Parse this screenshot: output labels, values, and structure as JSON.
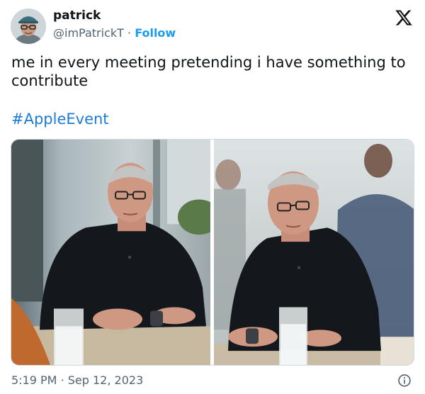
{
  "author": {
    "display_name": "patrick",
    "handle": "@imPatrickT",
    "separator": "·",
    "follow_label": "Follow"
  },
  "post": {
    "text": "me in every meeting pretending i have something to contribute",
    "hashtag": "#AppleEvent"
  },
  "footer": {
    "time": "5:19 PM",
    "separator": "·",
    "date": "Sep 12, 2023"
  },
  "icons": {
    "platform": "x-logo-icon",
    "info": "info-icon"
  },
  "colors": {
    "accent": "#1d9bf0",
    "hashtag": "#1d7bd6",
    "text": "#0f1419",
    "muted": "#536471",
    "border": "#cfd9de"
  }
}
